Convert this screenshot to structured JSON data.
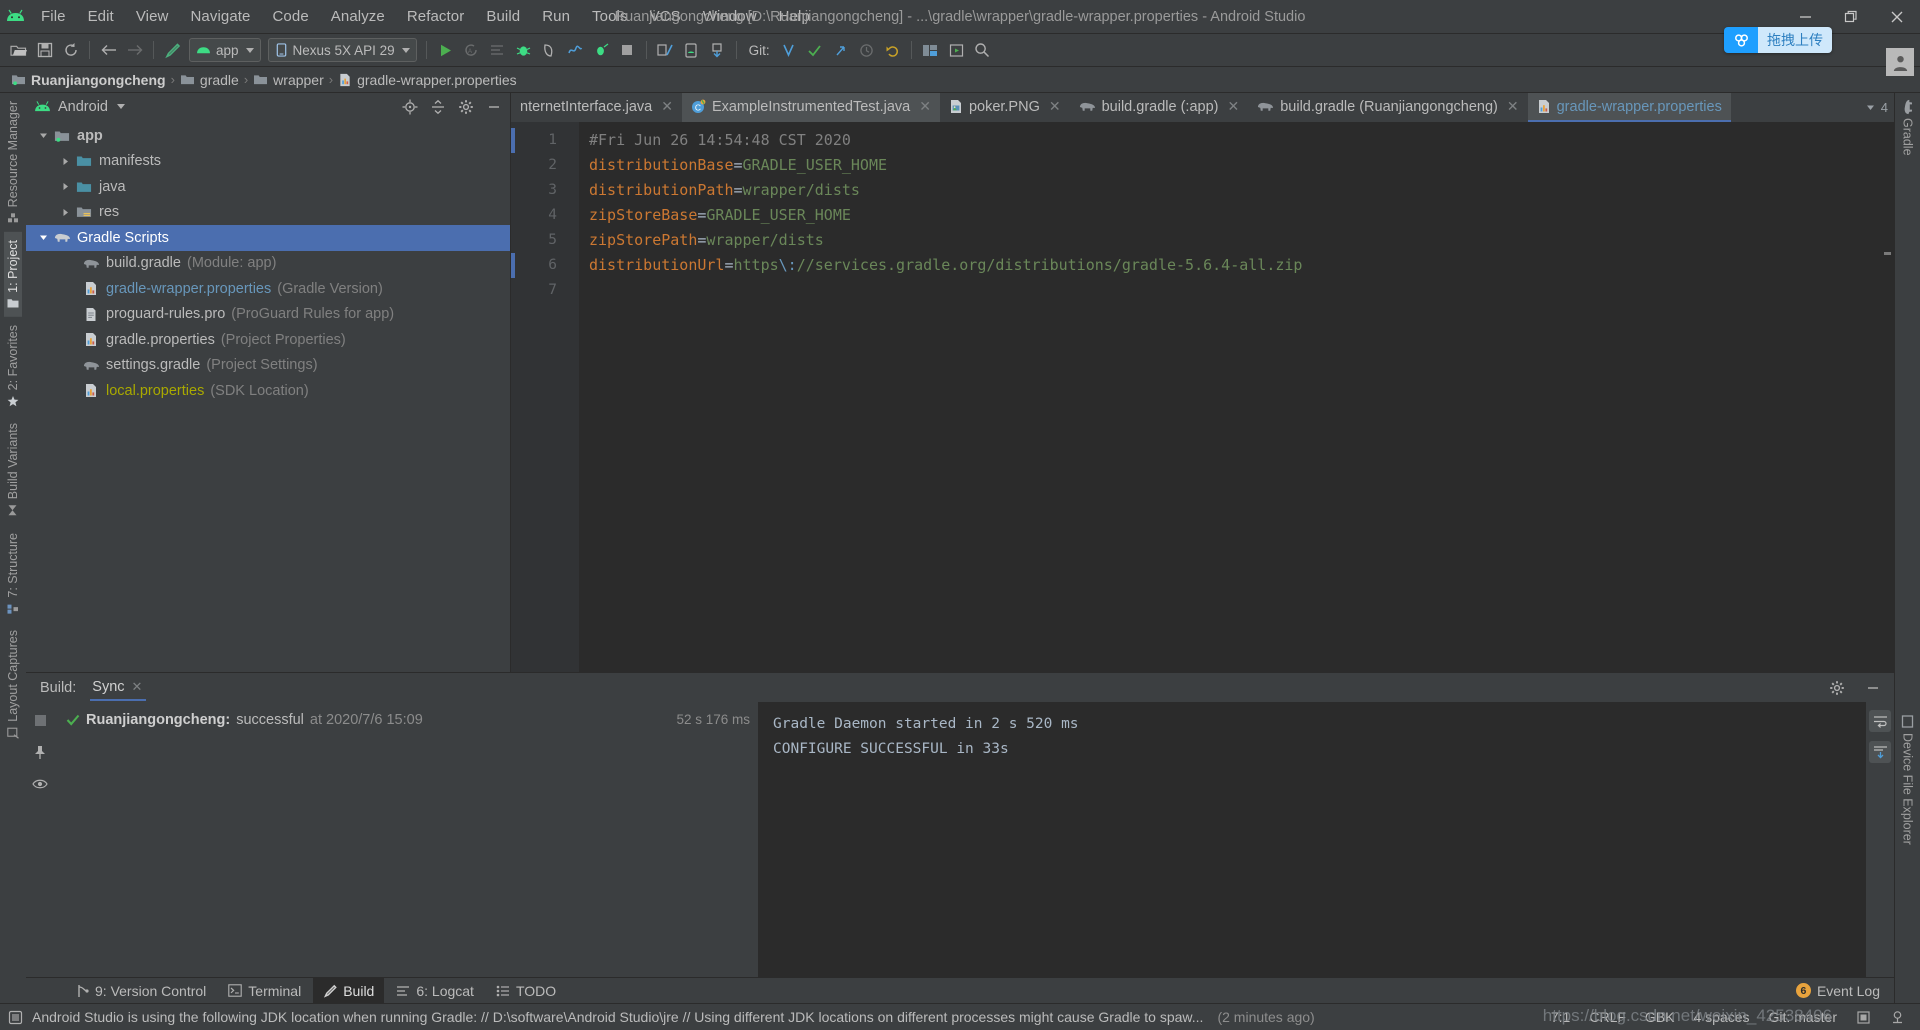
{
  "window": {
    "title": "Ruanjiangongcheng [D:\\Ruanjiangongcheng] - ...\\gradle\\wrapper\\gradle-wrapper.properties - Android Studio",
    "minimize": "minimize-icon",
    "maximize": "restore-icon",
    "close": "close-icon"
  },
  "overlay": {
    "upload_button_label": "拖拽上传",
    "watermark": "https://blog.csdn.net/weixin_42538406"
  },
  "menu": {
    "items": [
      {
        "label": "File",
        "mnemonic": "F"
      },
      {
        "label": "Edit",
        "mnemonic": "E"
      },
      {
        "label": "View",
        "mnemonic": "V"
      },
      {
        "label": "Navigate",
        "mnemonic": "N"
      },
      {
        "label": "Code",
        "mnemonic": "C"
      },
      {
        "label": "Analyze",
        "mnemonic": "z"
      },
      {
        "label": "Refactor",
        "mnemonic": "R"
      },
      {
        "label": "Build",
        "mnemonic": "B"
      },
      {
        "label": "Run",
        "mnemonic": "u"
      },
      {
        "label": "Tools",
        "mnemonic": "T"
      },
      {
        "label": "VCS",
        "mnemonic": "S"
      },
      {
        "label": "Window",
        "mnemonic": "W"
      },
      {
        "label": "Help",
        "mnemonic": "H"
      }
    ]
  },
  "toolbar": {
    "module_selector": "app",
    "device_selector": "Nexus 5X API 29",
    "git_label": "Git:",
    "icons": [
      "open-folder-icon",
      "save-all-icon",
      "sync-icon",
      "back-arrow-icon",
      "forward-arrow-icon",
      "build-hammer-icon"
    ]
  },
  "breadcrumb": {
    "items": [
      {
        "label": "Ruanjiangongcheng",
        "icon": "module-folder-icon",
        "bold": true
      },
      {
        "label": "gradle",
        "icon": "folder-icon",
        "bold": false
      },
      {
        "label": "wrapper",
        "icon": "folder-icon",
        "bold": false
      },
      {
        "label": "gradle-wrapper.properties",
        "icon": "properties-file-icon",
        "bold": false
      }
    ],
    "separator": "›"
  },
  "left_rail": {
    "tabs": [
      {
        "label": "Resource Manager",
        "icon": "resource-manager-icon",
        "active": false
      },
      {
        "label": "1: Project",
        "icon": "project-folder-icon",
        "active": true
      },
      {
        "label": "2: Favorites",
        "icon": "star-icon",
        "active": false
      },
      {
        "label": "Build Variants",
        "icon": "build-variants-icon",
        "active": false
      },
      {
        "label": "7: Structure",
        "icon": "structure-icon",
        "active": false
      },
      {
        "label": "Layout Captures",
        "icon": "layout-captures-icon",
        "active": false
      }
    ]
  },
  "right_rail": {
    "tabs": [
      {
        "label": "Gradle",
        "icon": "gradle-elephant-icon"
      },
      {
        "label": "Device File Explorer",
        "icon": "device-file-explorer-icon"
      }
    ]
  },
  "project_pane": {
    "title": "Android",
    "title_icon": "android-head-icon",
    "actions": [
      "locate-icon",
      "collapse-all-icon",
      "settings-gear-icon",
      "hide-icon"
    ],
    "tree": [
      {
        "depth": 0,
        "arrow": "down",
        "icon": "module-folder-icon",
        "label": "app",
        "sub": "",
        "bold": true,
        "selected": false,
        "color": "default"
      },
      {
        "depth": 1,
        "arrow": "right",
        "icon": "folder-icon",
        "label": "manifests",
        "sub": "",
        "bold": false,
        "selected": false,
        "color": "default"
      },
      {
        "depth": 1,
        "arrow": "right",
        "icon": "folder-icon",
        "label": "java",
        "sub": "",
        "bold": false,
        "selected": false,
        "color": "default"
      },
      {
        "depth": 1,
        "arrow": "right",
        "icon": "res-folder-icon",
        "label": "res",
        "sub": "",
        "bold": false,
        "selected": false,
        "color": "default"
      },
      {
        "depth": 0,
        "arrow": "down",
        "icon": "gradle-elephant-icon",
        "label": "Gradle Scripts",
        "sub": "",
        "bold": false,
        "selected": true,
        "color": "default"
      },
      {
        "depth": 1,
        "arrow": "none",
        "icon": "gradle-elephant-icon",
        "label": "build.gradle",
        "sub": "(Module: app)",
        "bold": false,
        "selected": false,
        "color": "default"
      },
      {
        "depth": 1,
        "arrow": "none",
        "icon": "properties-file-icon",
        "label": "gradle-wrapper.properties",
        "sub": "(Gradle Version)",
        "bold": false,
        "selected": false,
        "color": "blue"
      },
      {
        "depth": 1,
        "arrow": "none",
        "icon": "text-file-icon",
        "label": "proguard-rules.pro",
        "sub": "(ProGuard Rules for app)",
        "bold": false,
        "selected": false,
        "color": "default"
      },
      {
        "depth": 1,
        "arrow": "none",
        "icon": "properties-file-icon",
        "label": "gradle.properties",
        "sub": "(Project Properties)",
        "bold": false,
        "selected": false,
        "color": "default"
      },
      {
        "depth": 1,
        "arrow": "none",
        "icon": "gradle-elephant-icon",
        "label": "settings.gradle",
        "sub": "(Project Settings)",
        "bold": false,
        "selected": false,
        "color": "default"
      },
      {
        "depth": 1,
        "arrow": "none",
        "icon": "properties-file-icon",
        "label": "local.properties",
        "sub": "(SDK Location)",
        "bold": false,
        "selected": false,
        "color": "olive"
      }
    ]
  },
  "editor": {
    "tabs": [
      {
        "label": "nternetInterface.java",
        "icon": "java-class-icon",
        "active": false,
        "closable": true
      },
      {
        "label": "ExampleInstrumentedTest.java",
        "icon": "java-test-class-icon",
        "active": true,
        "closable": true
      },
      {
        "label": "poker.PNG",
        "icon": "image-file-icon",
        "active": false,
        "closable": true
      },
      {
        "label": "build.gradle (:app)",
        "icon": "gradle-elephant-icon",
        "active": false,
        "closable": true
      },
      {
        "label": "build.gradle (Ruanjiangongcheng)",
        "icon": "gradle-elephant-icon",
        "active": false,
        "closable": true
      },
      {
        "label": "gradle-wrapper.properties",
        "icon": "properties-file-icon",
        "active": false,
        "closable": false,
        "selected": true
      }
    ],
    "inspection_count": "4",
    "lines": [
      {
        "num": "1",
        "segments": [
          {
            "t": "#Fri Jun 26 14:54:48 CST 2020",
            "c": "comment"
          }
        ]
      },
      {
        "num": "2",
        "segments": [
          {
            "t": "distributionBase",
            "c": "key"
          },
          {
            "t": "=",
            "c": "eq"
          },
          {
            "t": "GRADLE_USER_HOME",
            "c": "val"
          }
        ]
      },
      {
        "num": "3",
        "segments": [
          {
            "t": "distributionPath",
            "c": "key"
          },
          {
            "t": "=",
            "c": "eq"
          },
          {
            "t": "wrapper/dists",
            "c": "val"
          }
        ]
      },
      {
        "num": "4",
        "segments": [
          {
            "t": "zipStoreBase",
            "c": "key"
          },
          {
            "t": "=",
            "c": "eq"
          },
          {
            "t": "GRADLE_USER_HOME",
            "c": "val"
          }
        ]
      },
      {
        "num": "5",
        "segments": [
          {
            "t": "zipStorePath",
            "c": "key"
          },
          {
            "t": "=",
            "c": "eq"
          },
          {
            "t": "wrapper/dists",
            "c": "val"
          }
        ]
      },
      {
        "num": "6",
        "segments": [
          {
            "t": "distributionUrl",
            "c": "key"
          },
          {
            "t": "=",
            "c": "eq"
          },
          {
            "t": "https",
            "c": "val"
          },
          {
            "t": "\\:",
            "c": "esc"
          },
          {
            "t": "//services.gradle.org/distributions/gradle-5.6.4-all.zip",
            "c": "val"
          }
        ]
      },
      {
        "num": "7",
        "segments": []
      }
    ]
  },
  "build_pane": {
    "label": "Build:",
    "tab": "Sync",
    "tab_close": "close-icon",
    "settings_icon": "settings-gear-icon",
    "hide_icon": "hide-icon",
    "result": {
      "status_icon": "success-check-icon",
      "project": "Ruanjiangongcheng:",
      "state": "successful",
      "at_label": "at 2020/7/6 15:09",
      "duration": "52 s 176 ms"
    },
    "console": [
      "Gradle Daemon started in 2 s 520 ms",
      "",
      "CONFIGURE SUCCESSFUL in 33s"
    ]
  },
  "bottom_tabs": {
    "tabs": [
      {
        "label": "9: Version Control",
        "icon": "version-control-icon",
        "active": false
      },
      {
        "label": "Terminal",
        "icon": "terminal-icon",
        "active": false
      },
      {
        "label": "Build",
        "icon": "build-hammer-icon",
        "active": true
      },
      {
        "label": "6: Logcat",
        "icon": "logcat-icon",
        "active": false
      },
      {
        "label": "TODO",
        "icon": "todo-list-icon",
        "active": false
      }
    ],
    "event_log": "Event Log",
    "event_log_badge": "6"
  },
  "status_bar": {
    "message_icon": "notification-icon",
    "message": "Android Studio is using the following JDK location when running Gradle: // D:\\software\\Android Studio\\jre // Using different JDK locations on different processes might cause Gradle to spaw...",
    "message_time": "(2 minutes ago)",
    "caret_position": "7:1",
    "line_separator": "CRLF",
    "encoding": "GBK",
    "indent": "4 spaces",
    "branch": "Git: master",
    "lock_icon": "read-only-icon",
    "inspector_icon": "inspections-icon"
  }
}
